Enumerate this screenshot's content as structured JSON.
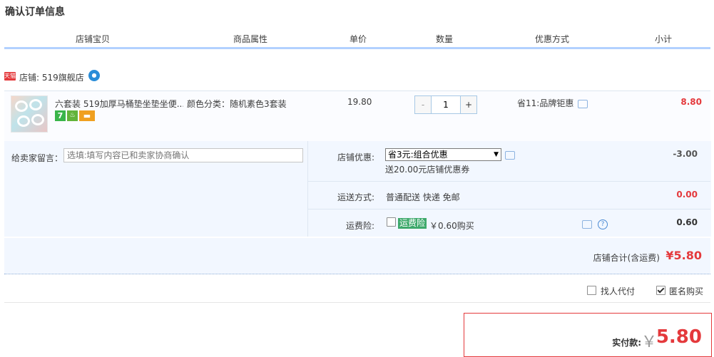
{
  "page_title": "确认订单信息",
  "columns": [
    "店铺宝贝",
    "商品属性",
    "单价",
    "数量",
    "优惠方式",
    "小计"
  ],
  "shop": {
    "badge": "天猫",
    "label": "店铺: 519旗舰店"
  },
  "item": {
    "name": "六套装 519加厚马桶垫坐垫坐便...",
    "service_icons": [
      "7",
      "♨",
      "▬"
    ],
    "attribute": "颜色分类：随机素色3套装",
    "unit_price": "19.80",
    "quantity": "1",
    "qty_minus": "-",
    "qty_plus": "+",
    "discount": "省11:品牌钜惠",
    "subtotal": "8.80"
  },
  "message": {
    "label": "给卖家留言：",
    "placeholder": "选填:填写内容已和卖家协商确认"
  },
  "shop_discount": {
    "label": "店铺优惠:",
    "selected": "省3元:组合优惠",
    "note": "送20.00元店铺优惠券",
    "amount": "-3.00"
  },
  "shipping": {
    "label": "运送方式:",
    "value": "普通配送 快递 免邮",
    "amount": "0.00"
  },
  "insurance": {
    "label": "运费险:",
    "tag": "运费险",
    "text": "￥0.60购买",
    "amount": "0.60",
    "help": "?"
  },
  "shop_total": {
    "label": "店铺合计(含运费)",
    "value": "¥5.80"
  },
  "options": {
    "proxy_pay": "找人代付",
    "anonymous": "匿名购买"
  },
  "payment": {
    "label": "实付款:",
    "currency": "￥",
    "value": "5.80"
  },
  "colors": {
    "accent_red": "#e4393c",
    "header_line": "#b2d1ff",
    "panel_bg": "#f2f7ff"
  }
}
